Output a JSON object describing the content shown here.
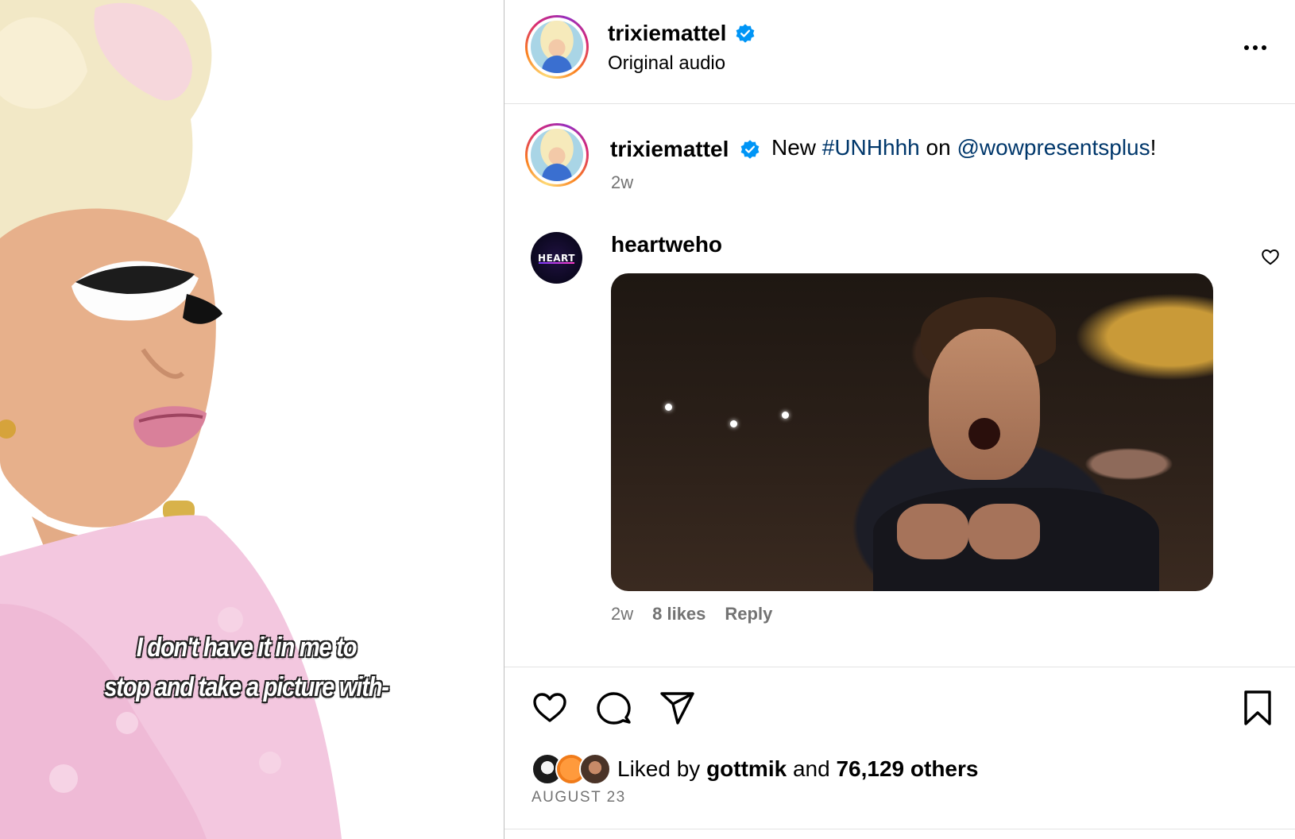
{
  "media": {
    "caption_line1": "I don't have it in me to",
    "caption_line2": "stop and take a picture with-"
  },
  "post_header": {
    "username": "trixiemattel",
    "verified": true,
    "audio_label": "Original audio",
    "more_icon": "more-horizontal-icon"
  },
  "caption": {
    "username": "trixiemattel",
    "text_prefix": "New",
    "hashtag": "#UNHhhh",
    "text_mid": "on",
    "mention": "@wowpresentsplus",
    "text_suffix": "!",
    "time": "2w"
  },
  "comment": {
    "username": "heartweho",
    "avatar_text": "HEART",
    "time": "2w",
    "likes": "8 likes",
    "reply_label": "Reply"
  },
  "actions": {
    "like_icon": "heart-icon",
    "comment_icon": "comment-icon",
    "share_icon": "send-icon",
    "save_icon": "bookmark-icon"
  },
  "likes": {
    "liked_by_label": "Liked by",
    "first_liker": "gottmik",
    "and_label": "and",
    "others": "76,129 others"
  },
  "date": "AUGUST 23",
  "colors": {
    "link": "#00376b",
    "secondary_text": "#737373",
    "verified": "#0095f6",
    "divider": "#e3e3e3"
  }
}
